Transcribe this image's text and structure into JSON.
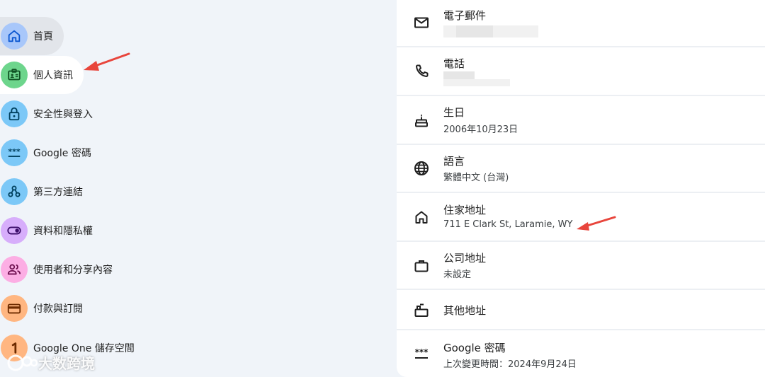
{
  "sidebar": {
    "items": [
      {
        "label": "首頁",
        "icon": "home-icon",
        "color": "#a8c7fa"
      },
      {
        "label": "個人資訊",
        "icon": "id-card-icon",
        "color": "#6dd58c"
      },
      {
        "label": "安全性與登入",
        "icon": "lock-icon",
        "color": "#7cc8f7"
      },
      {
        "label": "Google 密碼",
        "icon": "password-dots-icon",
        "color": "#7cc8f7"
      },
      {
        "label": "第三方連結",
        "icon": "connections-icon",
        "color": "#7cc8f7"
      },
      {
        "label": "資料和隱私權",
        "icon": "toggle-icon",
        "color": "#d7aefb"
      },
      {
        "label": "使用者和分享內容",
        "icon": "people-icon",
        "color": "#fcaee4"
      },
      {
        "label": "付款與訂閱",
        "icon": "wallet-icon",
        "color": "#ffb681"
      },
      {
        "label": "Google One 儲存空間",
        "icon": "google-one-icon",
        "color": "#ffb681"
      }
    ]
  },
  "panel": {
    "rows": [
      {
        "title": "電子郵件",
        "value": "",
        "icon": "mail-icon"
      },
      {
        "title": "電話",
        "value": "",
        "icon": "phone-icon"
      },
      {
        "title": "生日",
        "value": "2006年10月23日",
        "icon": "cake-icon"
      },
      {
        "title": "語言",
        "value": "繁體中文 (台灣)",
        "icon": "globe-icon"
      },
      {
        "title": "住家地址",
        "value": "711 E Clark St, Laramie, WY",
        "icon": "home-outline-icon"
      },
      {
        "title": "公司地址",
        "value": "未設定",
        "icon": "briefcase-icon"
      },
      {
        "title": "其他地址",
        "value": "",
        "icon": "mailbox-icon"
      },
      {
        "title": "Google 密碼",
        "value": "上次變更時間：2024年9月24日",
        "icon": "password-dots-icon"
      }
    ]
  },
  "annotations": {
    "arrow_color": "#e8453c"
  },
  "watermark": {
    "text": "大数跨境",
    "logo_text": "IC"
  }
}
